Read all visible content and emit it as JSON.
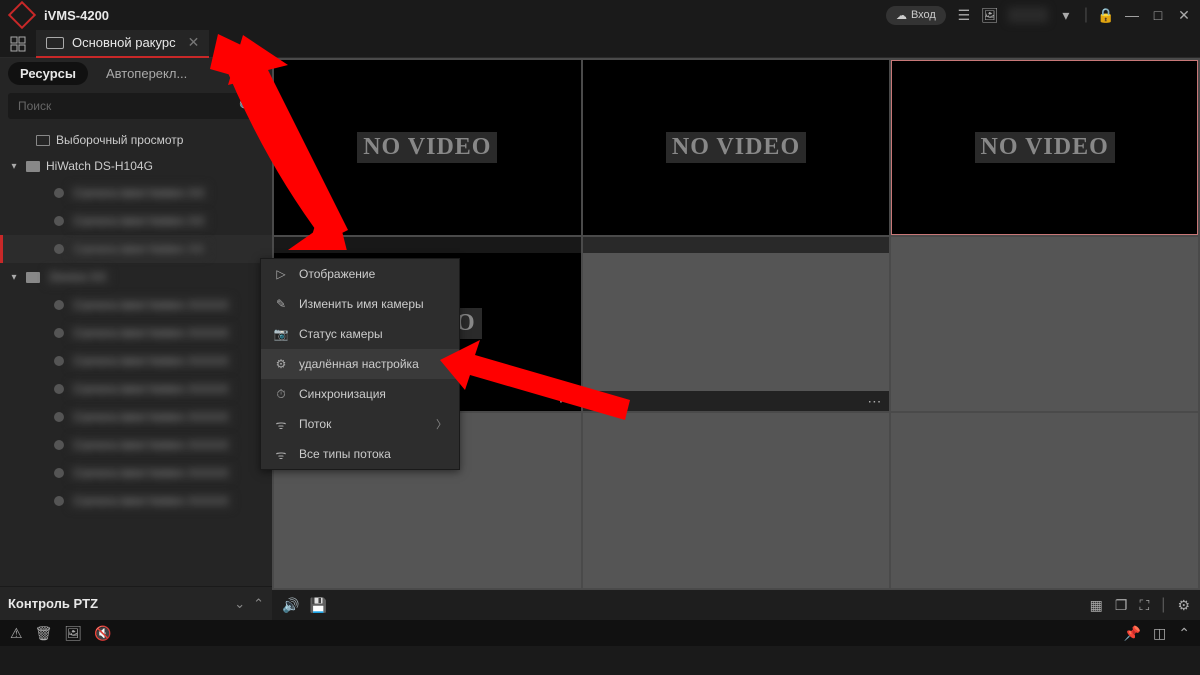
{
  "title_bar": {
    "app_name": "iVMS-4200",
    "login_label": "Вход"
  },
  "tab": {
    "label": "Основной ракурс"
  },
  "sidebar": {
    "tabs": {
      "resources": "Ресурсы",
      "autoswitch": "Автоперекл..."
    },
    "search_placeholder": "Поиск",
    "items": [
      {
        "label": "Выборочный просмотр"
      },
      {
        "label": "HiWatch DS-H104G"
      }
    ]
  },
  "grid": {
    "no_video": "NO VIDEO"
  },
  "ptz": {
    "title": "Контроль PTZ"
  },
  "context_menu": {
    "items": [
      {
        "label": "Отображение",
        "icon": "play"
      },
      {
        "label": "Изменить имя камеры",
        "icon": "edit"
      },
      {
        "label": "Статус камеры",
        "icon": "camera"
      },
      {
        "label": "удалённая настройка",
        "icon": "gear",
        "highlight": true
      },
      {
        "label": "Синхронизация",
        "icon": "clock"
      },
      {
        "label": "Поток",
        "icon": "stream",
        "submenu": true
      },
      {
        "label": "Все типы потока",
        "icon": "stream"
      }
    ]
  }
}
